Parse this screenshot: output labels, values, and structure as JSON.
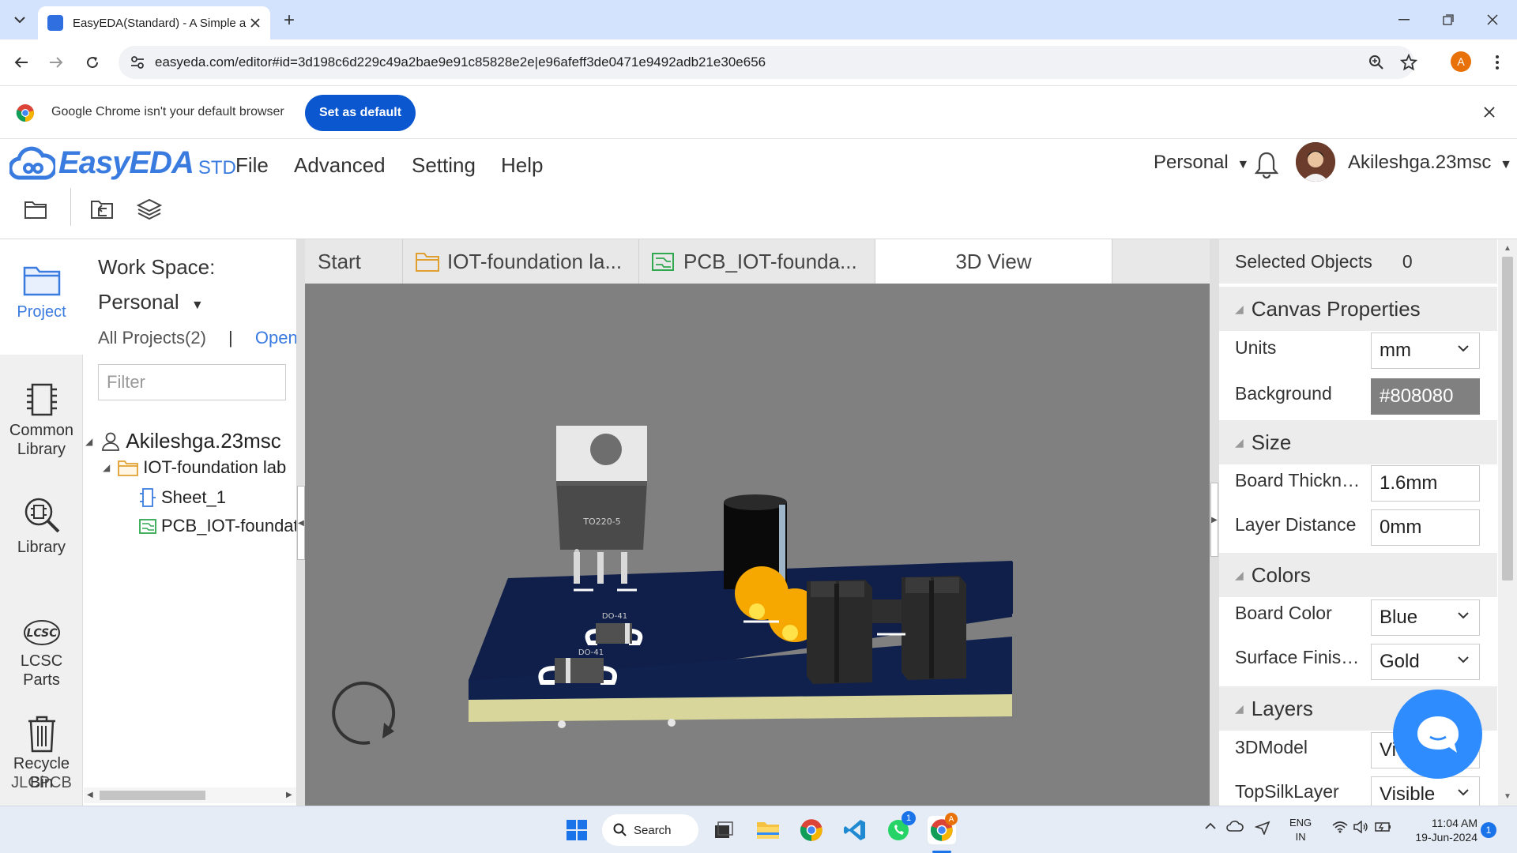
{
  "browser": {
    "tab_title": "EasyEDA(Standard) - A Simple a",
    "url": "easyeda.com/editor#id=3d198c6d229c49a2bae9e91c85828e2e|e96afeff3de0471e9492adb21e30e656",
    "profile_initial": "A",
    "infobar_text": "Google Chrome isn't your default browser",
    "infobar_button": "Set as default"
  },
  "app": {
    "logo_text": "EasyEDA",
    "logo_suffix": "STD",
    "menu": [
      "File",
      "Advanced",
      "Setting",
      "Help"
    ],
    "workspace_menu": "Personal",
    "user_name": "Akileshga.23msc"
  },
  "left_nav": {
    "items": [
      {
        "label": "Project"
      },
      {
        "label1": "Common",
        "label2": "Library"
      },
      {
        "label": "Library"
      },
      {
        "label1": "LCSC",
        "label2": "Parts"
      },
      {
        "label1": "Recycle",
        "label2": "Bin"
      },
      {
        "label": "JLCPCB"
      }
    ]
  },
  "project_panel": {
    "workspace_label": "Work Space:",
    "workspace_value": "Personal",
    "all_projects": "All Projects(2)",
    "separator": "|",
    "open_link": "Open",
    "filter_placeholder": "Filter",
    "tree": {
      "user": "Akileshga.23msc",
      "project": "IOT-foundation lab",
      "sheet": "Sheet_1",
      "pcb": "PCB_IOT-foundation"
    }
  },
  "doc_tabs": [
    "Start",
    "IOT-foundation la...",
    "PCB_IOT-founda...",
    "3D View"
  ],
  "canvas": {
    "background": "#808080",
    "component_label": "TO220-5"
  },
  "right_panel": {
    "selected_objects_label": "Selected Objects",
    "selected_objects_count": "0",
    "canvas_properties": "Canvas Properties",
    "units_label": "Units",
    "units_value": "mm",
    "background_label": "Background",
    "background_value": "#808080",
    "size_header": "Size",
    "board_thickness_label": "Board Thickn…",
    "board_thickness_value": "1.6mm",
    "layer_distance_label": "Layer Distance",
    "layer_distance_value": "0mm",
    "colors_header": "Colors",
    "board_color_label": "Board Color",
    "board_color_value": "Blue",
    "surface_finish_label": "Surface Finis…",
    "surface_finish_value": "Gold",
    "layers_header": "Layers",
    "model3d_label": "3DModel",
    "model3d_value": "Vi",
    "topsilk_label": "TopSilkLayer",
    "topsilk_value": "Visible"
  },
  "taskbar": {
    "search": "Search",
    "whatsapp_badge": "1",
    "lang1": "ENG",
    "lang2": "IN",
    "time": "11:04 AM",
    "date": "19-Jun-2024",
    "notification_count": "1"
  },
  "colors": {
    "accent": "#3a7be0",
    "chrome_blue": "#0b57d0",
    "board_blue": "#0f1f4a",
    "board_edge": "#d8d69a"
  }
}
